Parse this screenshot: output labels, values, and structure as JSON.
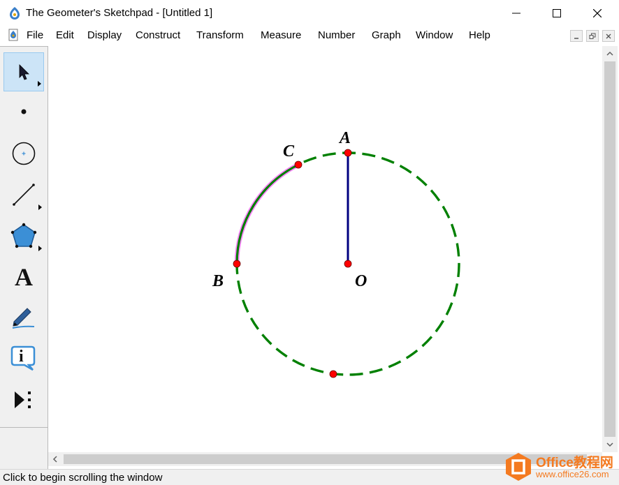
{
  "window": {
    "title": "The Geometer's Sketchpad - [Untitled 1]",
    "controls": [
      "minimize-icon",
      "maximize-icon",
      "close-icon"
    ]
  },
  "menubar": {
    "items": [
      "File",
      "Edit",
      "Display",
      "Construct",
      "Transform",
      "Measure",
      "Number",
      "Graph",
      "Window",
      "Help"
    ],
    "mdi_controls": [
      "restore-icon",
      "minimize-icon",
      "close-icon"
    ]
  },
  "toolbox": {
    "tools": [
      {
        "name": "arrow-tool",
        "icon": "arrow-icon",
        "selected": true
      },
      {
        "name": "point-tool",
        "icon": "point-icon"
      },
      {
        "name": "compass-tool",
        "icon": "compass-icon"
      },
      {
        "name": "straightedge-tool",
        "icon": "line-icon"
      },
      {
        "name": "polygon-tool",
        "icon": "polygon-icon"
      },
      {
        "name": "text-tool",
        "icon": "text-icon",
        "glyph": "A"
      },
      {
        "name": "marker-tool",
        "icon": "marker-icon"
      },
      {
        "name": "information-tool",
        "icon": "info-icon",
        "glyph": "i"
      },
      {
        "name": "custom-tool",
        "icon": "custom-tools-icon"
      }
    ]
  },
  "sketch": {
    "colors": {
      "circle": "#008000",
      "segment": "#000080",
      "arc": "#008000",
      "arc_highlight": "#ff80ff",
      "point": "#ff0000"
    },
    "labels": {
      "A": "A",
      "B": "B",
      "C": "C",
      "O": "O"
    }
  },
  "status": {
    "text": "Click to begin scrolling the window"
  },
  "watermark": {
    "title": "Office教程网",
    "url": "www.office26.com",
    "color": "#f47a20"
  }
}
